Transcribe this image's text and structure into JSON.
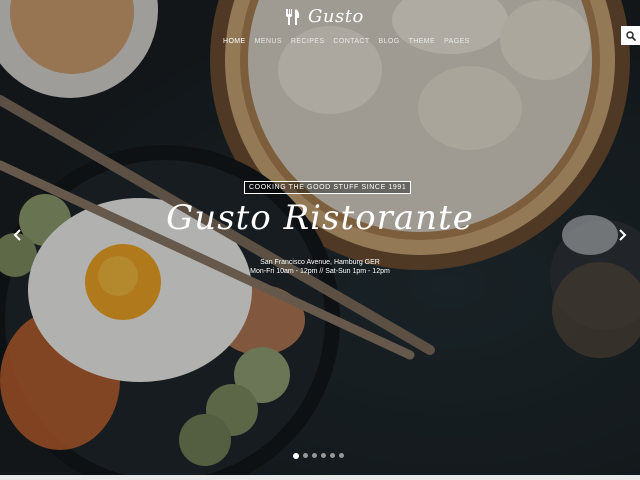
{
  "header": {
    "logo_text": "Gusto",
    "logo_icon": "fork-knife-icon",
    "nav": [
      {
        "label": "HOME",
        "active": true
      },
      {
        "label": "MENUS",
        "active": false
      },
      {
        "label": "RECIPES",
        "active": false
      },
      {
        "label": "CONTACT",
        "active": false
      },
      {
        "label": "BLOG",
        "active": false
      },
      {
        "label": "THEME",
        "active": false
      },
      {
        "label": "PAGES",
        "active": false
      }
    ],
    "search_icon": "search-icon"
  },
  "hero": {
    "tagline": "COOKING THE GOOD STUFF SINCE 1991",
    "title": "Gusto Ristorante",
    "address": "San Francisco Avenue, Hamburg GER",
    "hours": "Mon-Fri 10am - 12pm // Sat-Sun 1pm - 12pm",
    "prev_icon": "chevron-left-icon",
    "next_icon": "chevron-right-icon",
    "slides_count": 6,
    "active_slide": 1
  },
  "colors": {
    "text": "#ffffff",
    "background": "#1b2126",
    "accent": "#ffffff"
  }
}
